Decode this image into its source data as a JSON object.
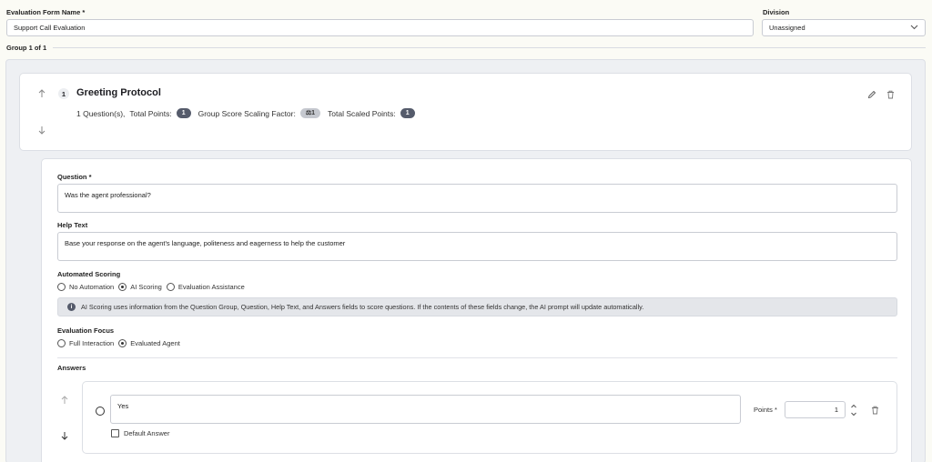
{
  "form": {
    "name_label": "Evaluation Form Name",
    "name_req": "*",
    "name_value": "Support Call Evaluation",
    "division_label": "Division",
    "division_value": "Unassigned",
    "group_label": "Group 1 of 1"
  },
  "group": {
    "number": "1",
    "title": "Greeting Protocol",
    "questions_text": "1 Question(s),",
    "total_points_label": "Total Points:",
    "total_points": "1",
    "scaling_label": "Group Score Scaling Factor:",
    "scaling_value": "1",
    "scaled_points_label": "Total Scaled Points:",
    "scaled_points": "1"
  },
  "question": {
    "label": "Question",
    "req": "*",
    "value": "Was the agent professional?",
    "help_label": "Help Text",
    "help_value": "Base your response on the agent's language, politeness and eagerness to help the customer",
    "scoring_label": "Automated Scoring",
    "scoring_options": [
      "No Automation",
      "AI Scoring",
      "Evaluation Assistance"
    ],
    "scoring_selected": "AI Scoring",
    "info_text": "AI Scoring uses information from the Question Group, Question, Help Text, and Answers fields to score questions. If the contents of these fields change, the AI prompt will update automatically.",
    "focus_label": "Evaluation Focus",
    "focus_options": [
      "Full Interaction",
      "Evaluated Agent"
    ],
    "focus_selected": "Evaluated Agent",
    "answers_label": "Answers"
  },
  "answer": {
    "value": "Yes",
    "default_label": "Default Answer",
    "points_label": "Points",
    "points_req": "*",
    "points_value": "1"
  },
  "colors": {
    "pill": "#555b6b",
    "border": "#c9ccd3",
    "panel": "#eef0f3"
  }
}
